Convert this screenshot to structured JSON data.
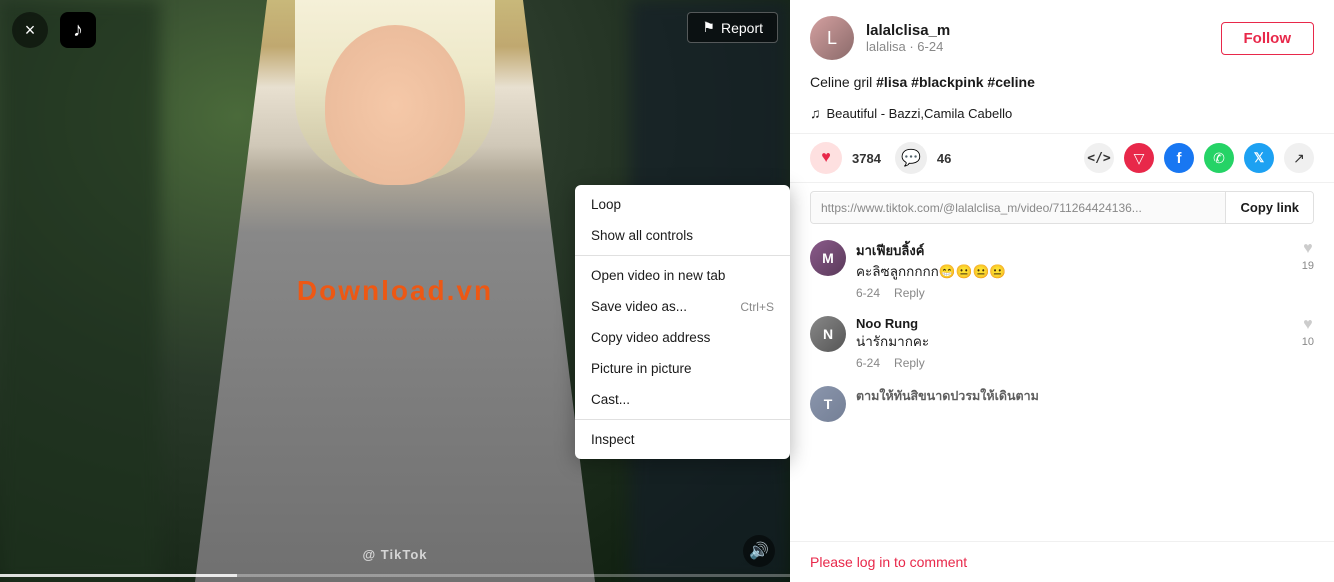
{
  "app": {
    "title": "TikTok"
  },
  "header": {
    "close_label": "×",
    "report_label": "Report",
    "tiktok_symbol": "♪"
  },
  "context_menu": {
    "items": [
      {
        "label": "Loop",
        "shortcut": ""
      },
      {
        "label": "Show all controls",
        "shortcut": ""
      },
      {
        "label": "Open video in new tab",
        "shortcut": ""
      },
      {
        "label": "Save video as...",
        "shortcut": "Ctrl+S"
      },
      {
        "label": "Copy video address",
        "shortcut": ""
      },
      {
        "label": "Picture in picture",
        "shortcut": ""
      },
      {
        "label": "Cast...",
        "shortcut": ""
      },
      {
        "label": "Inspect",
        "shortcut": ""
      }
    ]
  },
  "post": {
    "username": "lalalclisa_m",
    "subline": "lalalisa · 6-24",
    "follow_label": "Follow",
    "caption_text": "Celine gril ",
    "hashtags": "#lisa #blackpink #celine",
    "music_note": "♫",
    "music_title": "Beautiful - Bazzi,Camila Cabello"
  },
  "actions": {
    "like_count": "3784",
    "comment_count": "46",
    "share_icons": [
      "embed",
      "download",
      "facebook",
      "whatsapp",
      "twitter",
      "arrow"
    ]
  },
  "url_bar": {
    "url": "https://www.tiktok.com/@lalalclisa_m/video/711264424136...",
    "copy_label": "Copy link"
  },
  "comments": [
    {
      "username": "มาเฟียบลิ้งค์",
      "text": "คะลิซลูกกกกก😁😐😐😐",
      "date": "6-24",
      "reply": "Reply",
      "likes": "19"
    },
    {
      "username": "Noo Rung",
      "text": "น่ารักมากคะ",
      "date": "6-24",
      "reply": "Reply",
      "likes": "10"
    },
    {
      "username": "ตามให้ทันสิขนาดปวรมให้เดินตาม",
      "text": "",
      "date": "",
      "reply": "",
      "likes": ""
    }
  ],
  "footer": {
    "login_prompt": "Please log in to comment"
  },
  "watermark": {
    "text": "Download.vn"
  },
  "video": {
    "watermark": "@ TikTok"
  }
}
